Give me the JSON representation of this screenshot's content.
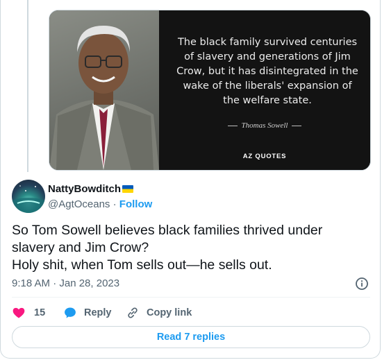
{
  "quoted_image": {
    "quote_lines": [
      "The black family survived centuries",
      "of slavery and generations of Jim",
      "Crow, but it has disintegrated in the",
      "wake of the liberals' expansion of",
      "the welfare state."
    ],
    "author": "Thomas Sowell",
    "brand": "AZ QUOTES"
  },
  "author": {
    "display_name": "NattyBowditch",
    "handle": "@AgtOceans",
    "separator": " · ",
    "follow_label": "Follow"
  },
  "tweet": {
    "lines": [
      "So Tom Sowell believes black families thrived under",
      "slavery and Jim Crow?",
      "Holy shit, when Tom sells out—he sells out."
    ],
    "timestamp": "9:18 AM · Jan 28, 2023"
  },
  "actions": {
    "like_count": "15",
    "reply_label": "Reply",
    "copy_link_label": "Copy link"
  },
  "read_replies_label": "Read 7 replies",
  "colors": {
    "accent": "#1d9bf0",
    "like": "#f91880",
    "muted_text": "#536471",
    "border": "#cfd9de"
  }
}
